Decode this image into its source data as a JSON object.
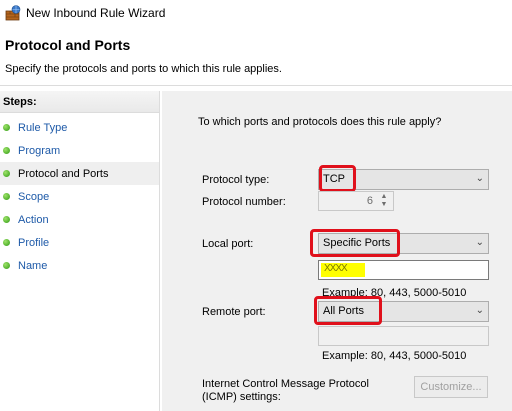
{
  "window": {
    "title": "New Inbound Rule Wizard"
  },
  "header": {
    "title": "Protocol and Ports",
    "subtitle": "Specify the protocols and ports to which this rule applies."
  },
  "steps": {
    "heading": "Steps:",
    "items": [
      {
        "label": "Rule Type"
      },
      {
        "label": "Program"
      },
      {
        "label": "Protocol and Ports"
      },
      {
        "label": "Scope"
      },
      {
        "label": "Action"
      },
      {
        "label": "Profile"
      },
      {
        "label": "Name"
      }
    ]
  },
  "main": {
    "question": "To which ports and protocols does this rule apply?",
    "protocol_type": {
      "label": "Protocol type:",
      "value": "TCP"
    },
    "protocol_number": {
      "label": "Protocol number:",
      "value": "6"
    },
    "local_port": {
      "label": "Local port:",
      "value": "Specific Ports",
      "input_value": "XXXX",
      "example": "Example: 80, 443, 5000-5010"
    },
    "remote_port": {
      "label": "Remote port:",
      "value": "All Ports",
      "input_value": "",
      "example": "Example: 80, 443, 5000-5010"
    },
    "icmp": {
      "label_line1": "Internet Control Message Protocol",
      "label_line2": "(ICMP) settings:",
      "button_label": "Customize..."
    }
  },
  "icons": {
    "dropdown": "chevron-down-icon",
    "step_bullet": "green-dot-icon",
    "app": "firewall-icon"
  },
  "colors": {
    "annotation_red": "#e0101b",
    "highlight_yellow": "#ffff00",
    "step_link": "#1e5aa8"
  }
}
